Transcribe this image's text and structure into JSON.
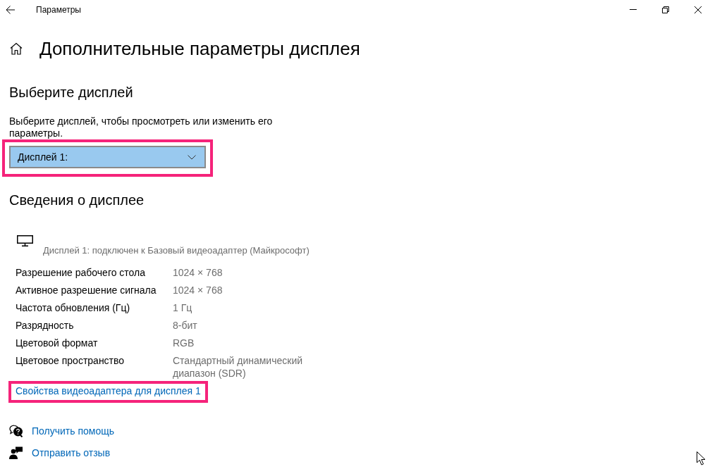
{
  "window": {
    "title": "Параметры"
  },
  "page": {
    "title": "Дополнительные параметры дисплея"
  },
  "select_display": {
    "heading": "Выберите дисплей",
    "description": "Выберите дисплей, чтобы просмотреть или изменить его параметры.",
    "dropdown": {
      "value": "Дисплей 1:",
      "highlighted": true
    }
  },
  "display_info": {
    "heading": "Сведения о дисплее",
    "connection": "Дисплей 1: подключен к Базовый видеоадаптер (Майкрософт)",
    "properties": [
      {
        "label": "Разрешение рабочего стола",
        "value": "1024 × 768"
      },
      {
        "label": "Активное разрешение сигнала",
        "value": "1024 × 768"
      },
      {
        "label": "Частота обновления (Гц)",
        "value": "1 Гц"
      },
      {
        "label": "Разрядность",
        "value": "8-бит"
      },
      {
        "label": "Цветовой формат",
        "value": "RGB"
      },
      {
        "label": "Цветовое пространство",
        "value": "Стандартный динамический диапазон (SDR)"
      }
    ],
    "adapter_link": {
      "label": "Свойства видеоадаптера для дисплея 1",
      "highlighted": true
    }
  },
  "help_links": [
    {
      "kind": "help",
      "label": "Получить помощь"
    },
    {
      "kind": "feedback",
      "label": "Отправить отзыв"
    }
  ]
}
